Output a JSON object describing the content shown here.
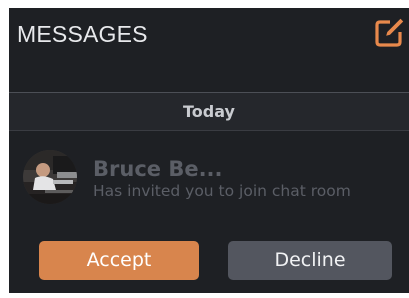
{
  "header": {
    "title": "MESSAGES",
    "compose_icon": "compose-edit-icon",
    "accent_color": "#e8894c"
  },
  "date_section": {
    "label": "Today"
  },
  "notification": {
    "sender_name": "Bruce Be...",
    "message": "Has invited you to join chat room",
    "avatar_icon": "user-avatar-photo",
    "accept_label": "Accept",
    "decline_label": "Decline"
  },
  "colors": {
    "background": "#1e2024",
    "accept": "#d8854d",
    "decline": "#53565f",
    "muted_text": "#5b5e66"
  }
}
